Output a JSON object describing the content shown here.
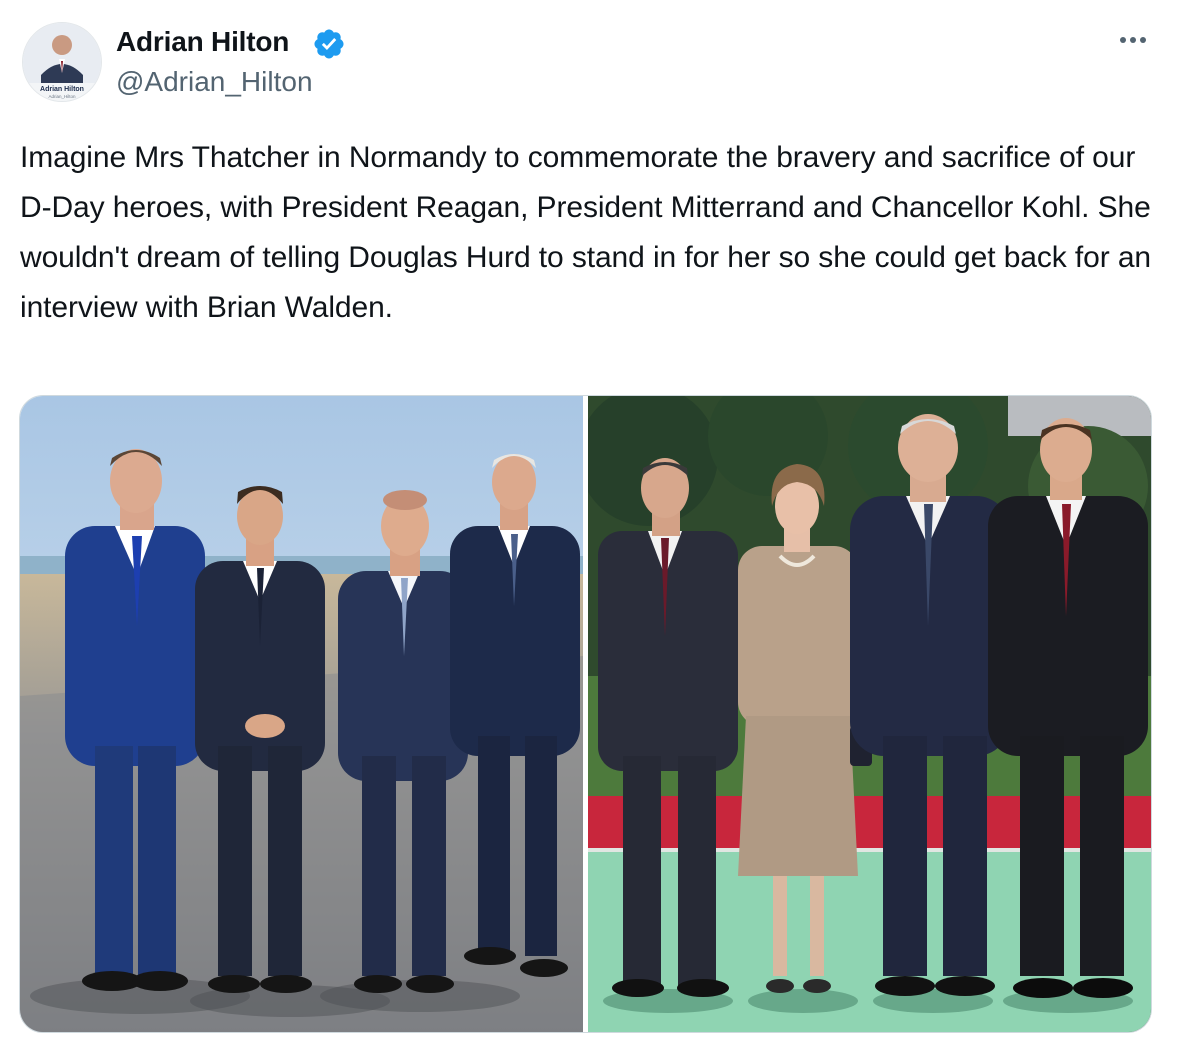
{
  "author": {
    "display_name": "Adrian Hilton",
    "handle": "@Adrian_Hilton",
    "verified": true,
    "avatar_caption": "Adrian Hilton",
    "avatar_subcaption": "Adrian_Hilton"
  },
  "tweet": {
    "text": "Imagine Mrs Thatcher in Normandy to commemorate the bravery and sacrifice of our D-Day heroes, with President Reagan, President Mitterrand and Chancellor Kohl. She wouldn't dream of telling Douglas Hurd to stand in for her so she could get back for an interview with Brian Walden."
  },
  "icons": {
    "verified": "verified-badge-icon",
    "more": "more-options-icon"
  },
  "colors": {
    "verified_blue": "#1d9bf0",
    "text_primary": "#0f1419",
    "text_secondary": "#536471",
    "border": "#cfd9de"
  }
}
